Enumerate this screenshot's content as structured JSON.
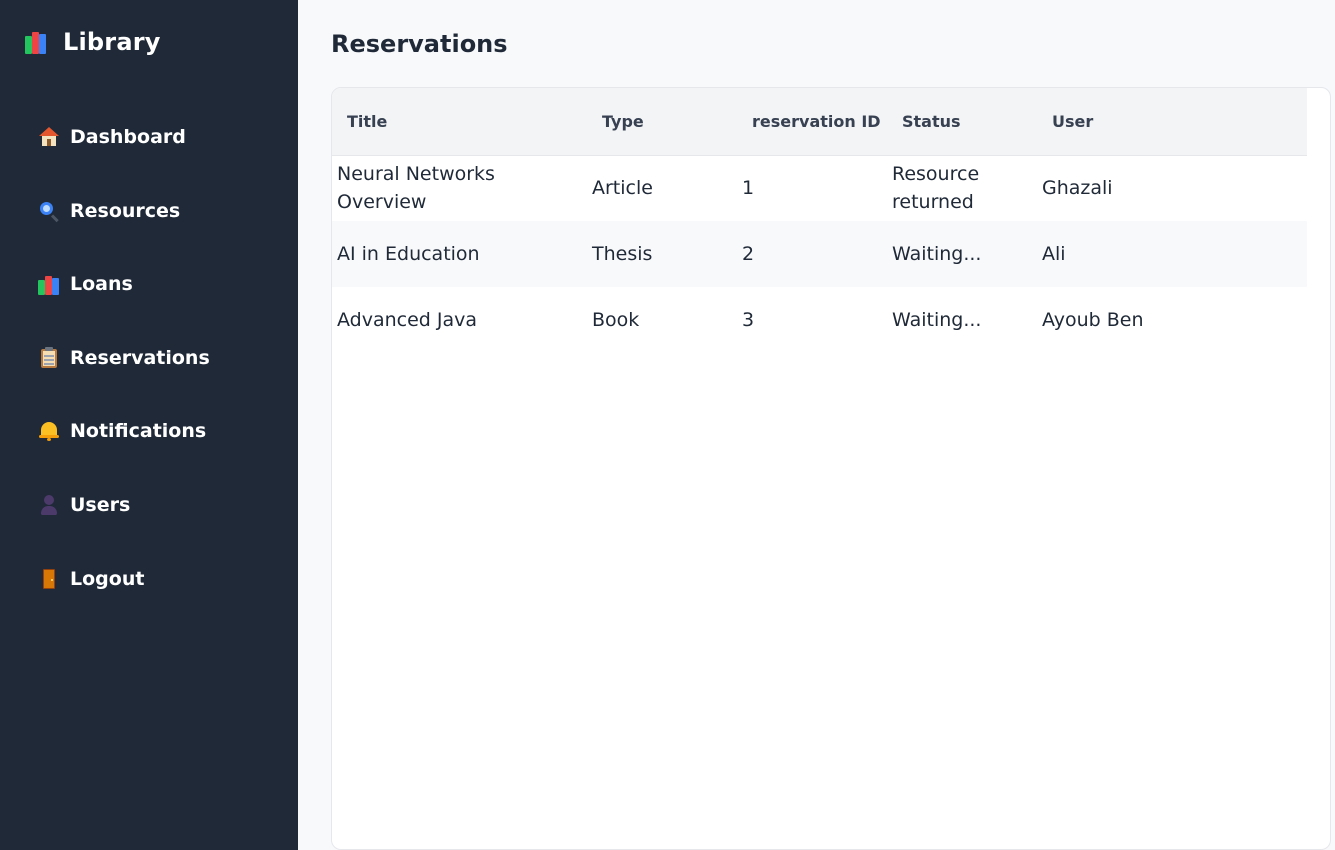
{
  "sidebar": {
    "brand": {
      "title": "Library",
      "icon": "books-icon"
    },
    "items": [
      {
        "label": "Dashboard",
        "icon": "house-icon"
      },
      {
        "label": "Resources",
        "icon": "magnifier-icon"
      },
      {
        "label": "Loans",
        "icon": "books-icon"
      },
      {
        "label": "Reservations",
        "icon": "clipboard-icon"
      },
      {
        "label": "Notifications",
        "icon": "bell-icon"
      },
      {
        "label": "Users",
        "icon": "user-icon"
      },
      {
        "label": "Logout",
        "icon": "door-icon"
      }
    ]
  },
  "main": {
    "title": "Reservations",
    "table": {
      "columns": [
        "Title",
        "Type",
        "reservation ID",
        "Status",
        "User"
      ],
      "rows": [
        {
          "title": "Neural Networks Overview",
          "type": "Article",
          "id": "1",
          "status": "Resource returned",
          "user": "Ghazali"
        },
        {
          "title": "AI in Education",
          "type": "Thesis",
          "id": "2",
          "status": "Waiting...",
          "user": "Ali"
        },
        {
          "title": "Advanced Java",
          "type": "Book",
          "id": "3",
          "status": "Waiting...",
          "user": "Ayoub Ben"
        }
      ]
    }
  },
  "colors": {
    "sidebar_bg": "#1f2937",
    "sidebar_text": "#ffffff",
    "page_bg": "#f8f9fb",
    "table_header_bg": "#f3f4f6",
    "text_dark": "#1f2937"
  }
}
